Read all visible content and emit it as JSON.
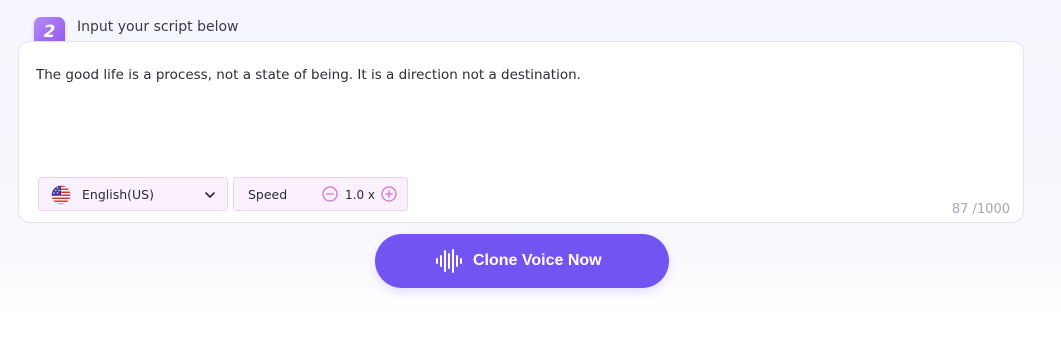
{
  "step": {
    "number": "2",
    "title": "Input your script below"
  },
  "script": {
    "text": "The good life is a process, not a state of being. It is a direction not a destination.",
    "char_count": "87 /1000"
  },
  "language": {
    "selected": "English(US)",
    "flag_icon": "us-flag-icon",
    "dropdown_icon": "chevron-down-icon"
  },
  "speed": {
    "label": "Speed",
    "value": "1.0 x",
    "minus_icon": "minus-circle-icon",
    "plus_icon": "plus-circle-icon"
  },
  "action": {
    "label": "Clone Voice Now",
    "icon": "sound-wave-icon"
  },
  "colors": {
    "accent": "#7353f2",
    "badge": "#9b63f0",
    "control_bg": "#fbf1fc",
    "control_icon": "#d96fd3"
  }
}
